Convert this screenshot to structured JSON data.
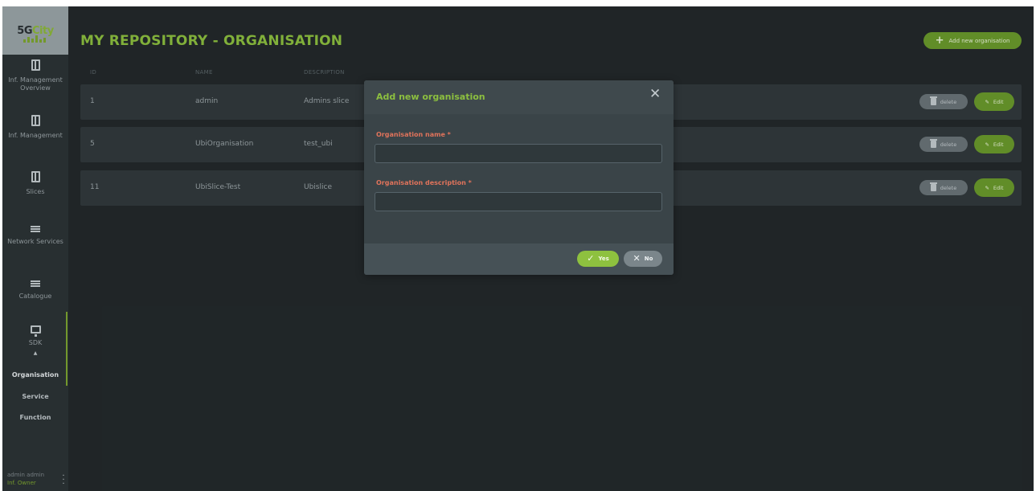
{
  "app": {
    "logo": {
      "prefix": "5G",
      "city": "City"
    },
    "page_title": "MY REPOSITORY - ORGANISATION",
    "add_button_label": "Add new organisation"
  },
  "sidebar": {
    "items": [
      {
        "label": "Inf. Management Overview",
        "icon": "map-icon"
      },
      {
        "label": "Inf. Management",
        "icon": "map-icon"
      },
      {
        "label": "Slices",
        "icon": "map-icon"
      },
      {
        "label": "Network Services",
        "icon": "list-icon"
      },
      {
        "label": "Catalogue",
        "icon": "list-icon"
      },
      {
        "label": "SDK",
        "icon": "monitor-icon"
      }
    ],
    "sdk_caret": "▲",
    "sub_items": [
      {
        "label": "Organisation",
        "active": true
      },
      {
        "label": "Service",
        "active": false
      },
      {
        "label": "Function",
        "active": false
      }
    ],
    "user": {
      "name": "admin admin",
      "role": "Inf. Owner"
    }
  },
  "table": {
    "headers": [
      "ID",
      "NAME",
      "DESCRIPTION"
    ],
    "rows": [
      {
        "id": "1",
        "name": "admin",
        "description": "Admins slice"
      },
      {
        "id": "5",
        "name": "UbiOrganisation",
        "description": "test_ubi"
      },
      {
        "id": "11",
        "name": "UbiSlice-Test",
        "description": "Ubislice"
      }
    ],
    "delete_label": "delete",
    "edit_label": "Edit"
  },
  "modal": {
    "title": "Add new organisation",
    "close_icon": "close-icon",
    "fields": [
      {
        "label": "Organisation name *",
        "value": ""
      },
      {
        "label": "Organisation description *",
        "value": ""
      }
    ],
    "yes_label": "Yes",
    "no_label": "No"
  },
  "colors": {
    "accent": "#8cbf3f",
    "required": "#e0735b",
    "background": "#23292b"
  }
}
